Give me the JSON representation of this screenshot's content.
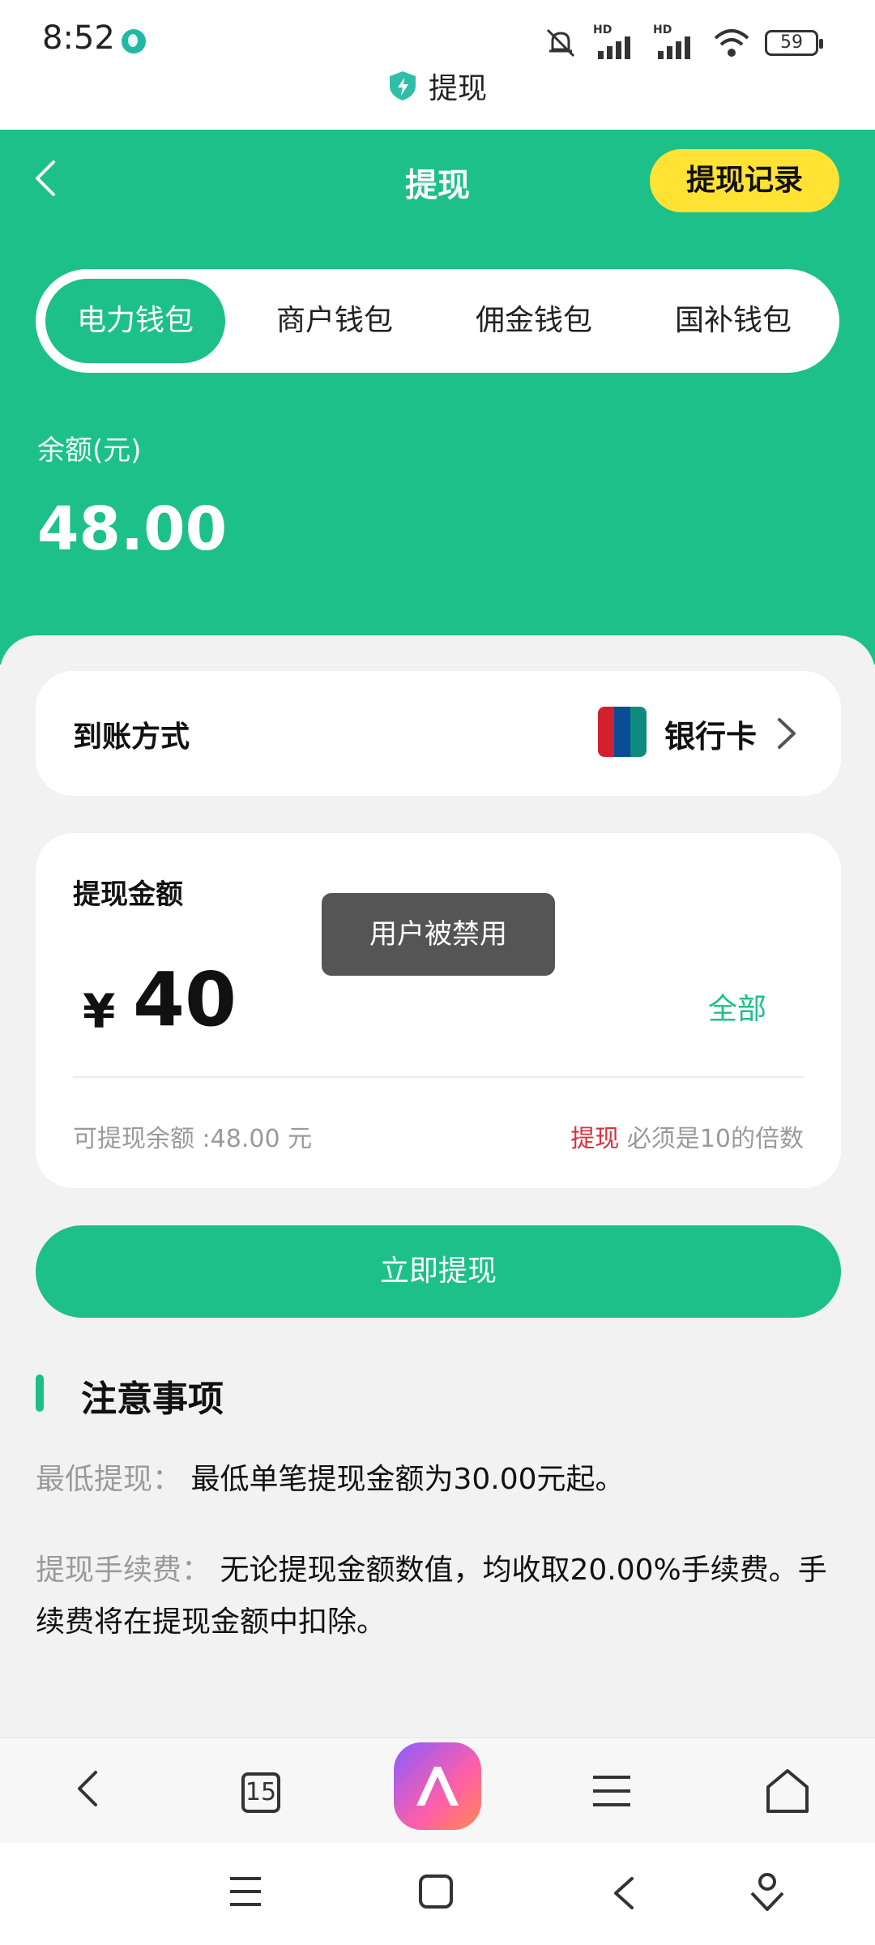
{
  "status_bar": {
    "time": "8:52",
    "battery": "59",
    "network_labels": [
      "HD",
      "HD"
    ]
  },
  "browser": {
    "page_title": "提现",
    "tab_count": "15"
  },
  "header": {
    "title": "提现",
    "record_button": "提现记录",
    "tabs": [
      {
        "label": "电力钱包",
        "active": true
      },
      {
        "label": "商户钱包",
        "active": false
      },
      {
        "label": "佣金钱包",
        "active": false
      },
      {
        "label": "国补钱包",
        "active": false
      }
    ],
    "balance_label": "余额(元)",
    "balance_value": "48.00"
  },
  "method": {
    "label": "到账方式",
    "value": "银行卡"
  },
  "amount": {
    "title": "提现金额",
    "currency": "¥",
    "value": "40",
    "all_button": "全部",
    "available": "可提现余额 :48.00 元",
    "rule_highlight": "提现",
    "rule_text": "必须是10的倍数"
  },
  "toast": "用户被禁用",
  "withdraw_button": "立即提现",
  "notes": {
    "title": "注意事项",
    "items": [
      {
        "label": "最低提现：",
        "text": "最低单笔提现金额为30.00元起。"
      },
      {
        "label": "提现手续费：",
        "text": "无论提现金额数值，均收取20.00%手续费。手续费将在提现金额中扣除。"
      }
    ]
  },
  "colors": {
    "primary": "#1dc089",
    "accent_yellow": "#ffe234",
    "warning_red": "#d9313b"
  }
}
